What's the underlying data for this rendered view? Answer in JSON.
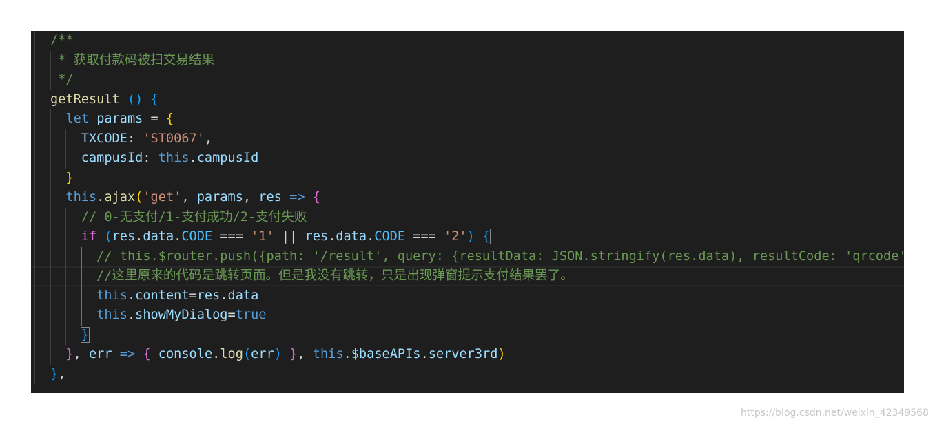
{
  "editor": {
    "lines": [
      {
        "indent": 0,
        "tokens": [
          [
            "/**",
            "c"
          ]
        ]
      },
      {
        "indent": 0,
        "tokens": [
          [
            " * 获取付款码被扫交易结果",
            "c"
          ]
        ]
      },
      {
        "indent": 0,
        "tokens": [
          [
            " */",
            "c"
          ]
        ]
      },
      {
        "indent": 0,
        "tokens": [
          [
            "getResult",
            "f"
          ],
          [
            " ",
            "p"
          ],
          [
            "()",
            "b3"
          ],
          [
            " ",
            "p"
          ],
          [
            "{",
            "b3"
          ]
        ]
      },
      {
        "indent": 1,
        "tokens": [
          [
            "let",
            "k"
          ],
          [
            " ",
            "p"
          ],
          [
            "params",
            "v"
          ],
          [
            " = ",
            "p"
          ],
          [
            "{",
            "b1"
          ]
        ]
      },
      {
        "indent": 2,
        "tokens": [
          [
            "TXCODE",
            "v"
          ],
          [
            ": ",
            "p"
          ],
          [
            "'ST0067'",
            "s"
          ],
          [
            ",",
            "p"
          ]
        ]
      },
      {
        "indent": 2,
        "tokens": [
          [
            "campusId",
            "v"
          ],
          [
            ": ",
            "p"
          ],
          [
            "this",
            "k"
          ],
          [
            ".",
            "p"
          ],
          [
            "campusId",
            "v"
          ]
        ]
      },
      {
        "indent": 1,
        "tokens": [
          [
            "}",
            "b1"
          ]
        ]
      },
      {
        "indent": 1,
        "tokens": [
          [
            "this",
            "k"
          ],
          [
            ".",
            "p"
          ],
          [
            "ajax",
            "f"
          ],
          [
            "(",
            "b1"
          ],
          [
            "'get'",
            "s"
          ],
          [
            ", ",
            "p"
          ],
          [
            "params",
            "v"
          ],
          [
            ", ",
            "p"
          ],
          [
            "res",
            "v"
          ],
          [
            " ",
            "p"
          ],
          [
            "=>",
            "k"
          ],
          [
            " ",
            "p"
          ],
          [
            "{",
            "b2"
          ]
        ]
      },
      {
        "indent": 2,
        "tokens": [
          [
            "// 0-无支付/1-支付成功/2-支付失败",
            "c"
          ]
        ]
      },
      {
        "indent": 2,
        "tokens": [
          [
            "if",
            "b2"
          ],
          [
            " ",
            "p"
          ],
          [
            "(",
            "b3"
          ],
          [
            "res",
            "v"
          ],
          [
            ".",
            "p"
          ],
          [
            "data",
            "v"
          ],
          [
            ".",
            "p"
          ],
          [
            "CODE",
            "cn"
          ],
          [
            " === ",
            "p"
          ],
          [
            "'1'",
            "s"
          ],
          [
            " || ",
            "p"
          ],
          [
            "res",
            "v"
          ],
          [
            ".",
            "p"
          ],
          [
            "data",
            "v"
          ],
          [
            ".",
            "p"
          ],
          [
            "CODE",
            "cn"
          ],
          [
            " === ",
            "p"
          ],
          [
            "'2'",
            "s"
          ],
          [
            ")",
            "b3"
          ],
          [
            " ",
            "p"
          ],
          [
            "{",
            "b3 m"
          ]
        ]
      },
      {
        "indent": 3,
        "tokens": [
          [
            "// this.$router.push({path: '/result', query: {resultData: JSON.stringify(res.data), resultCode: 'qrcode'}})",
            "c"
          ]
        ]
      },
      {
        "indent": 3,
        "current": true,
        "tokens": [
          [
            "//这里原来的代码是跳转页面。但是我没有跳转，只是出现弹窗提示支付结果罢了。",
            "c"
          ]
        ]
      },
      {
        "indent": 3,
        "tokens": [
          [
            "this",
            "k"
          ],
          [
            ".",
            "p"
          ],
          [
            "content",
            "v"
          ],
          [
            "=",
            "p"
          ],
          [
            "res",
            "v"
          ],
          [
            ".",
            "p"
          ],
          [
            "data",
            "v"
          ]
        ]
      },
      {
        "indent": 3,
        "tokens": [
          [
            "this",
            "k"
          ],
          [
            ".",
            "p"
          ],
          [
            "showMyDialog",
            "v"
          ],
          [
            "=",
            "p"
          ],
          [
            "true",
            "k"
          ]
        ]
      },
      {
        "indent": 2,
        "tokens": [
          [
            "}",
            "b3 m"
          ]
        ]
      },
      {
        "indent": 1,
        "tokens": [
          [
            "}",
            "b2"
          ],
          [
            ", ",
            "p"
          ],
          [
            "err",
            "v"
          ],
          [
            " ",
            "p"
          ],
          [
            "=>",
            "k"
          ],
          [
            " ",
            "p"
          ],
          [
            "{",
            "b2"
          ],
          [
            " ",
            "p"
          ],
          [
            "console",
            "v"
          ],
          [
            ".",
            "p"
          ],
          [
            "log",
            "f"
          ],
          [
            "(",
            "b3"
          ],
          [
            "err",
            "v"
          ],
          [
            ")",
            "b3"
          ],
          [
            " ",
            "p"
          ],
          [
            "}",
            "b2"
          ],
          [
            ", ",
            "p"
          ],
          [
            "this",
            "k"
          ],
          [
            ".",
            "p"
          ],
          [
            "$baseAPIs",
            "v"
          ],
          [
            ".",
            "p"
          ],
          [
            "server3rd",
            "v"
          ],
          [
            ")",
            "b1"
          ]
        ]
      },
      {
        "indent": 0,
        "tokens": [
          [
            "}",
            "b3"
          ],
          [
            ",",
            "p"
          ]
        ]
      }
    ]
  },
  "watermark": "https://blog.csdn.net/weixin_42349568"
}
